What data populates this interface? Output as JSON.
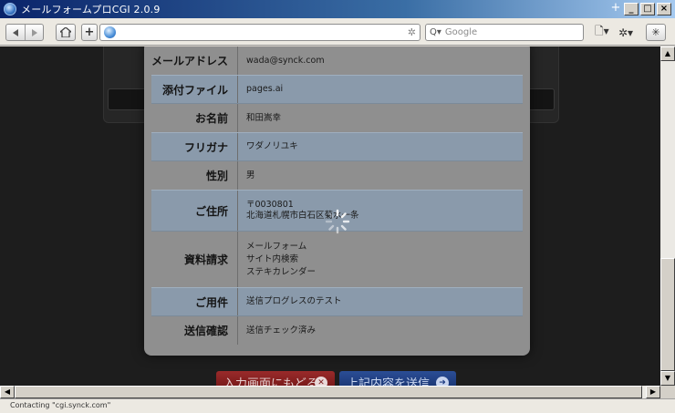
{
  "window": {
    "title": "メールフォームプロCGI 2.0.9",
    "new_tab_label": "+"
  },
  "toolbar": {
    "back_icon": "back-arrow-icon",
    "forward_icon": "forward-arrow-icon",
    "search_placeholder": "Google",
    "url_value": ""
  },
  "form": {
    "rows": [
      {
        "label": "メールアドレス",
        "lines": [
          "wada@synck.com"
        ]
      },
      {
        "label": "添付ファイル",
        "lines": [
          "pages.ai"
        ]
      },
      {
        "label": "お名前",
        "lines": [
          "和田嵩幸"
        ]
      },
      {
        "label": "フリガナ",
        "lines": [
          "ワダノリユキ"
        ]
      },
      {
        "label": "性別",
        "lines": [
          "男"
        ]
      },
      {
        "label": "ご住所",
        "lines": [
          "〒0030801",
          "北海道札幌市白石区菊水一条"
        ]
      },
      {
        "label": "資料請求",
        "lines": [
          "メールフォーム",
          "サイト内検索",
          "ステキカレンダー"
        ]
      },
      {
        "label": "ご用件",
        "lines": [
          "送信プログレスのテスト"
        ]
      },
      {
        "label": "送信確認",
        "lines": [
          "送信チェック済み"
        ]
      }
    ]
  },
  "buttons": {
    "back_label": "入力画面にもどる",
    "send_label": "上記内容を送信"
  },
  "status": {
    "text": "Contacting \"cgi.synck.com\""
  },
  "colors": {
    "accent_red": "#9a2a2a",
    "accent_blue": "#2b4e96"
  }
}
